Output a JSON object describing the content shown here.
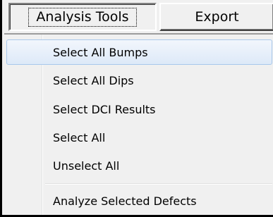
{
  "menubar": {
    "items": [
      {
        "label": "Analysis Tools"
      },
      {
        "label": "Export"
      }
    ]
  },
  "dropdown": {
    "items": [
      {
        "label": "Select All Bumps"
      },
      {
        "label": "Select All Dips"
      },
      {
        "label": "Select DCI Results"
      },
      {
        "label": "Select All"
      },
      {
        "label": "Unselect All"
      },
      {
        "label": "Analyze Selected Defects"
      }
    ]
  }
}
